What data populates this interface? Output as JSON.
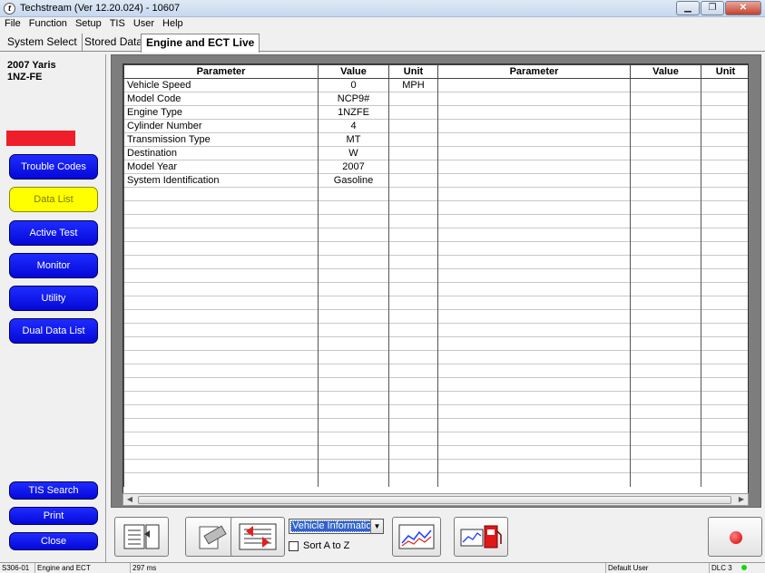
{
  "window": {
    "title": "Techstream (Ver 12.20.024) - 10607",
    "controls": [
      "minimize",
      "maximize",
      "close"
    ]
  },
  "menu": [
    "File",
    "Function",
    "Setup",
    "TIS",
    "User",
    "Help"
  ],
  "tabs": [
    {
      "label": "System Select",
      "active": false
    },
    {
      "label": "Stored Data",
      "active": false
    },
    {
      "label": "Engine and ECT Live",
      "active": true
    }
  ],
  "vehicle": {
    "line1": "2007 Yaris",
    "line2": "1NZ-FE"
  },
  "colors": {
    "accent_blue": "#0a10f0",
    "selected_yellow": "#ffff00",
    "status_red": "#ee1f2a",
    "data_area_grey": "#7d7d7d"
  },
  "sidebar": {
    "buttons": [
      {
        "label": "Trouble Codes",
        "selected": false
      },
      {
        "label": "Data List",
        "selected": true
      },
      {
        "label": "Active Test",
        "selected": false
      },
      {
        "label": "Monitor",
        "selected": false
      },
      {
        "label": "Utility",
        "selected": false
      },
      {
        "label": "Dual Data List",
        "selected": false
      }
    ],
    "bottom_buttons": [
      {
        "label": "TIS Search"
      },
      {
        "label": "Print"
      },
      {
        "label": "Close"
      }
    ]
  },
  "table": {
    "headers": [
      "Parameter",
      "Value",
      "Unit",
      "Parameter",
      "Value",
      "Unit"
    ],
    "rows": [
      {
        "parameter": "Vehicle Speed",
        "value": "0",
        "unit": "MPH"
      },
      {
        "parameter": "Model Code",
        "value": "NCP9#",
        "unit": ""
      },
      {
        "parameter": "Engine Type",
        "value": "1NZFE",
        "unit": ""
      },
      {
        "parameter": "Cylinder Number",
        "value": "4",
        "unit": ""
      },
      {
        "parameter": "Transmission Type",
        "value": "MT",
        "unit": ""
      },
      {
        "parameter": "Destination",
        "value": "W",
        "unit": ""
      },
      {
        "parameter": "Model Year",
        "value": "2007",
        "unit": ""
      },
      {
        "parameter": "System Identification",
        "value": "Gasoline",
        "unit": ""
      }
    ]
  },
  "toolbar": {
    "group_select": "Vehicle Information",
    "sort_label": "Sort A to Z",
    "sort_checked": false,
    "icons": [
      "list-select-icon",
      "snapshot-icon",
      "list-swap-icon",
      "graph-icon",
      "fuel-graph-icon",
      "record-icon"
    ]
  },
  "status": {
    "code": "S306-01",
    "system": "Engine and ECT",
    "timing": "297 ms",
    "user": "Default User",
    "connection": "DLC 3"
  }
}
